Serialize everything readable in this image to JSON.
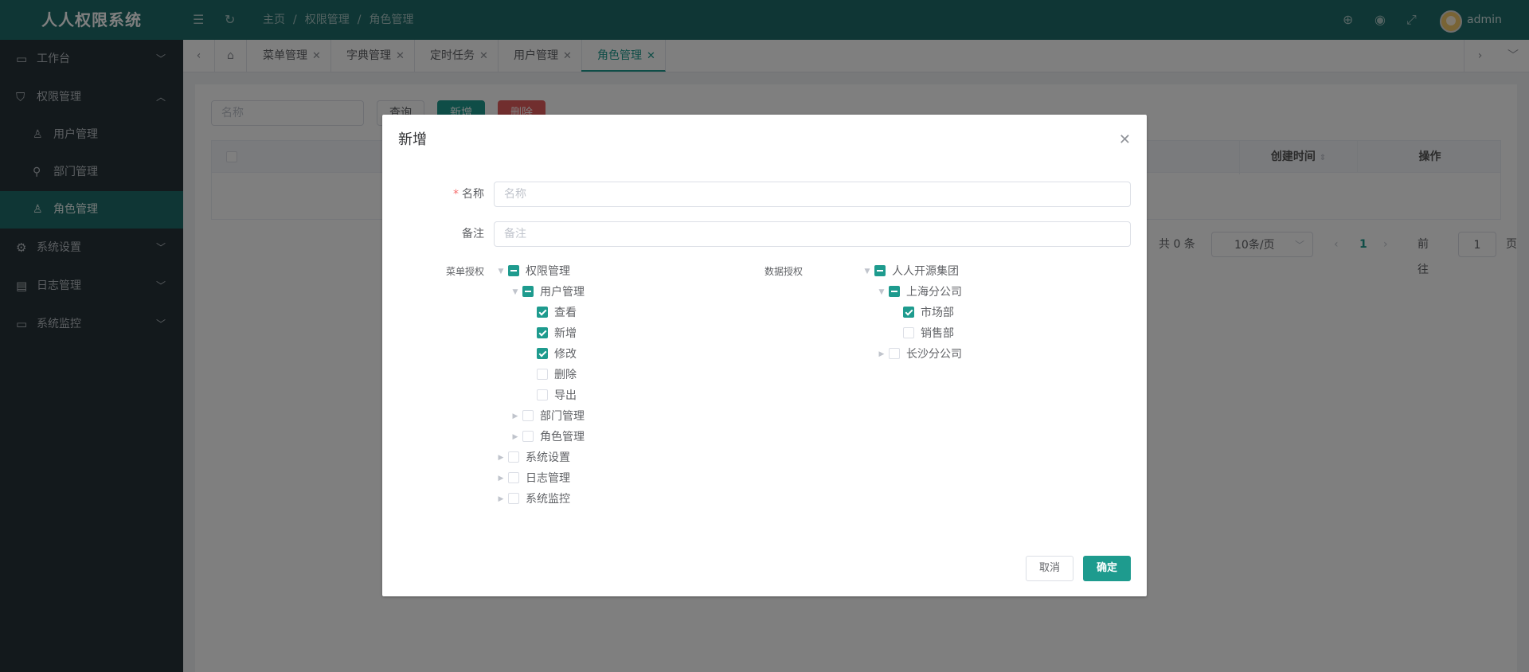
{
  "app": {
    "title": "人人权限系统"
  },
  "header": {
    "breadcrumb": [
      "主页",
      "权限管理",
      "角色管理"
    ],
    "username": "admin"
  },
  "sidebar": {
    "items": [
      {
        "label": "工作台",
        "icon": "monitor-icon"
      },
      {
        "label": "权限管理",
        "icon": "shield-icon"
      },
      {
        "label": "用户管理",
        "icon": "user-icon"
      },
      {
        "label": "部门管理",
        "icon": "org-icon"
      },
      {
        "label": "角色管理",
        "icon": "role-icon"
      },
      {
        "label": "系统设置",
        "icon": "gear-icon"
      },
      {
        "label": "日志管理",
        "icon": "log-icon"
      },
      {
        "label": "系统监控",
        "icon": "monitor-icon"
      }
    ]
  },
  "tabs": [
    "菜单管理",
    "字典管理",
    "定时任务",
    "用户管理",
    "角色管理"
  ],
  "main": {
    "search_placeholder": "名称",
    "query_label": "查询",
    "add_label": "新增",
    "delete_label": "删除",
    "col_created": "创建时间",
    "col_ops": "操作",
    "total": "共 0 条",
    "page_size": "10条/页",
    "current_page": "1",
    "goto_label": "前往",
    "goto_value": "1",
    "page_suffix": "页"
  },
  "dialog": {
    "title": "新增",
    "name_label": "名称",
    "name_placeholder": "名称",
    "remark_label": "备注",
    "remark_placeholder": "备注",
    "menu_auth_label": "菜单授权",
    "data_auth_label": "数据授权",
    "menu_tree": [
      {
        "label": "权限管理",
        "state": "indeterminate",
        "toggle": "expanded"
      },
      {
        "label": "用户管理",
        "state": "indeterminate",
        "toggle": "expanded"
      },
      {
        "label": "查看",
        "state": "checked",
        "toggle": "none"
      },
      {
        "label": "新增",
        "state": "checked",
        "toggle": "none"
      },
      {
        "label": "修改",
        "state": "checked",
        "toggle": "none"
      },
      {
        "label": "删除",
        "state": "unchecked",
        "toggle": "none"
      },
      {
        "label": "导出",
        "state": "unchecked",
        "toggle": "none"
      },
      {
        "label": "部门管理",
        "state": "unchecked",
        "toggle": "collapsed"
      },
      {
        "label": "角色管理",
        "state": "unchecked",
        "toggle": "collapsed"
      },
      {
        "label": "系统设置",
        "state": "unchecked",
        "toggle": "collapsed"
      },
      {
        "label": "日志管理",
        "state": "unchecked",
        "toggle": "collapsed"
      },
      {
        "label": "系统监控",
        "state": "unchecked",
        "toggle": "collapsed"
      }
    ],
    "data_tree": [
      {
        "label": "人人开源集团",
        "state": "indeterminate",
        "toggle": "expanded"
      },
      {
        "label": "上海分公司",
        "state": "indeterminate",
        "toggle": "expanded"
      },
      {
        "label": "市场部",
        "state": "checked",
        "toggle": "none"
      },
      {
        "label": "销售部",
        "state": "unchecked",
        "toggle": "none"
      },
      {
        "label": "长沙分公司",
        "state": "unchecked",
        "toggle": "collapsed"
      }
    ],
    "cancel_label": "取消",
    "ok_label": "确定"
  },
  "colors": {
    "brand": "#1e6d6a",
    "accent": "#1e9b8e",
    "danger": "#e25c5c",
    "sidebar_bg": "#263238"
  }
}
